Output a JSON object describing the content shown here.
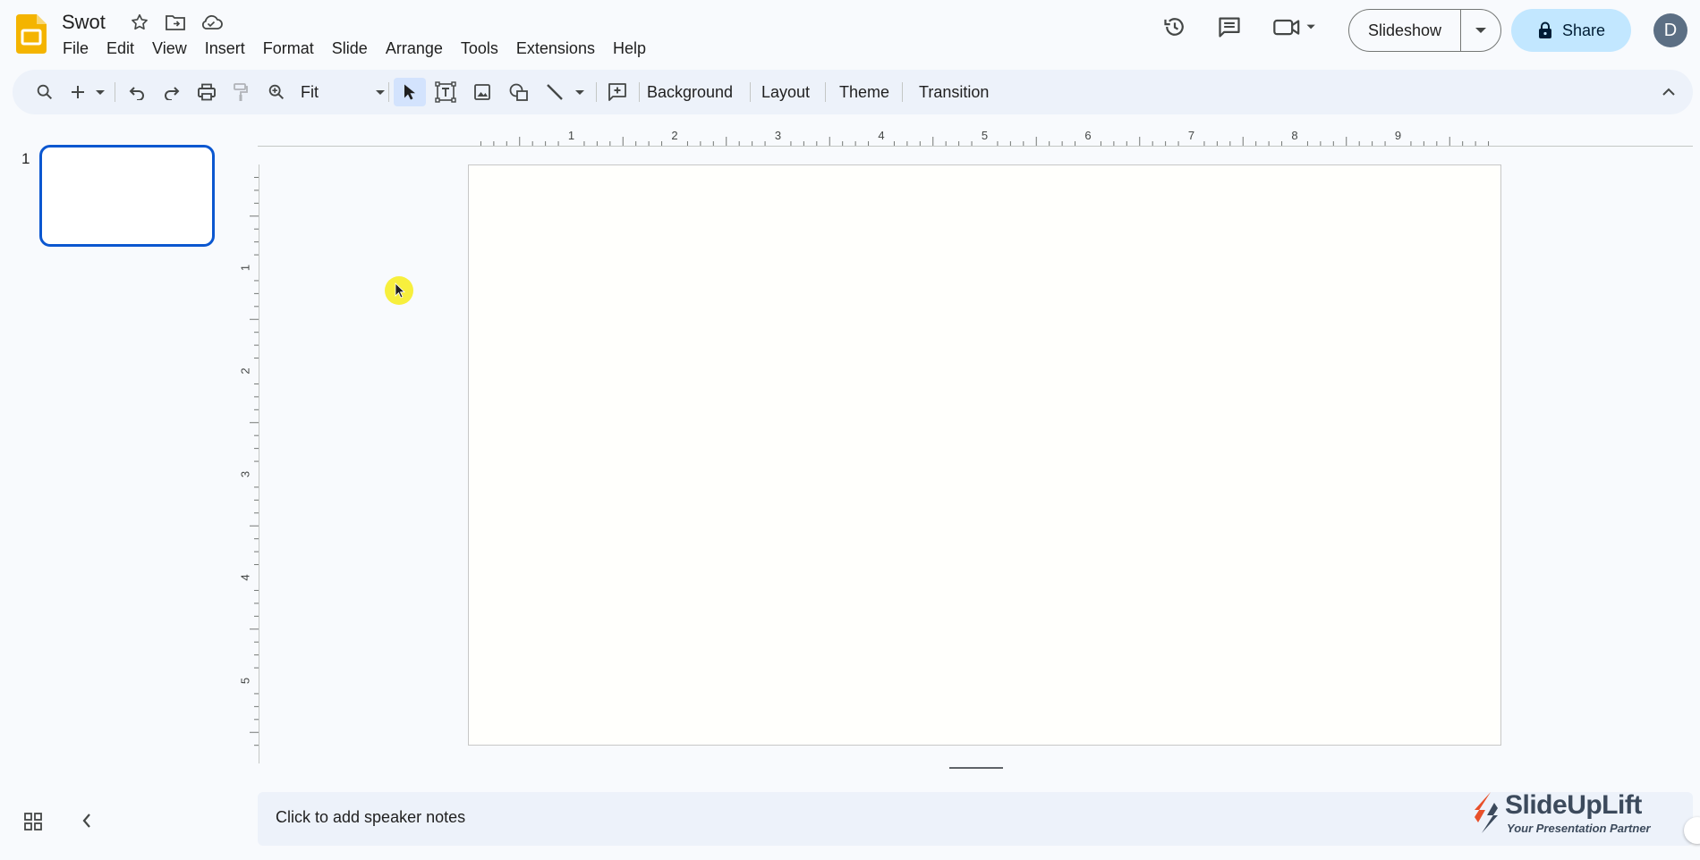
{
  "app": {
    "title": "Swot",
    "brand_color": "#f4b400",
    "accent_color": "#0b57d0"
  },
  "menubar": {
    "items": [
      "File",
      "Edit",
      "View",
      "Insert",
      "Format",
      "Slide",
      "Arrange",
      "Tools",
      "Extensions",
      "Help"
    ]
  },
  "header": {
    "slideshow_label": "Slideshow",
    "share_label": "Share",
    "avatar_initial": "D",
    "icons": [
      "version-history-icon",
      "comments-icon",
      "meet-camera-icon"
    ]
  },
  "toolbar": {
    "zoom_value": "Fit",
    "background_label": "Background",
    "layout_label": "Layout",
    "theme_label": "Theme",
    "transition_label": "Transition"
  },
  "filmstrip": {
    "slides": [
      {
        "number": "1"
      }
    ]
  },
  "rulers": {
    "horizontal_labels": [
      "1",
      "2",
      "3",
      "4",
      "5",
      "6",
      "7",
      "8",
      "9"
    ],
    "vertical_labels": [
      "1",
      "2",
      "3",
      "4",
      "5"
    ]
  },
  "notes": {
    "placeholder": "Click to add speaker notes"
  },
  "watermark": {
    "name": "SlideUpLift",
    "tagline": "Your Presentation Partner"
  }
}
